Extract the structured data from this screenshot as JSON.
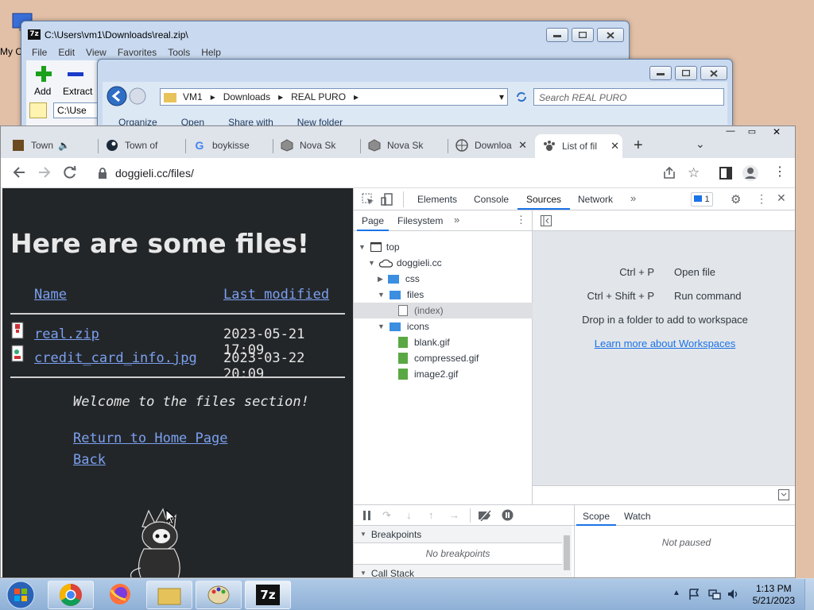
{
  "desktop": {
    "icon_label": "My C"
  },
  "zip_window": {
    "title": "C:\\Users\\vm1\\Downloads\\real.zip\\",
    "menu": [
      "File",
      "Edit",
      "View",
      "Favorites",
      "Tools",
      "Help"
    ],
    "add_label": "Add",
    "extract_label": "Extract",
    "path_partial": "C:\\Use"
  },
  "explorer_window": {
    "breadcrumb": [
      "VM1",
      "Downloads",
      "REAL PURO"
    ],
    "search_placeholder": "Search REAL PURO",
    "commands": [
      "Organize",
      "Open",
      "Share with",
      "New folder"
    ]
  },
  "browser": {
    "tabs": [
      {
        "label": "Town",
        "icon": "town-icon"
      },
      {
        "label": "Town of",
        "icon": "steam-icon"
      },
      {
        "label": "boykisse",
        "icon": "google-icon"
      },
      {
        "label": "Nova Sk",
        "icon": "cube-icon"
      },
      {
        "label": "Nova Sk",
        "icon": "cube-icon"
      },
      {
        "label": "Downloa",
        "icon": "globe-icon"
      },
      {
        "label": "List of fil",
        "icon": "paw-icon",
        "active": true
      }
    ],
    "url": "doggieli.cc/files/"
  },
  "page": {
    "heading": "Here are some files!",
    "col_name": "Name",
    "col_modified": "Last modified",
    "files": [
      {
        "name": "real.zip",
        "modified": "2023-05-21 17:09"
      },
      {
        "name": "credit_card_info.jpg",
        "modified": "2023-03-22 20:09"
      }
    ],
    "welcome": "Welcome to the files section!",
    "home_link": "Return to Home Page",
    "back_link": "Back"
  },
  "devtools": {
    "tabs": [
      "Elements",
      "Console",
      "Sources",
      "Network"
    ],
    "active_tab": "Sources",
    "issues_count": "1",
    "subtabs": [
      "Page",
      "Filesystem"
    ],
    "tree": {
      "top": "top",
      "domain": "doggieli.cc",
      "css": "css",
      "files": "files",
      "index": "(index)",
      "icons": "icons",
      "icon_files": [
        "blank.gif",
        "compressed.gif",
        "image2.gif"
      ]
    },
    "shortcuts": [
      {
        "keys": "Ctrl + P",
        "action": "Open file"
      },
      {
        "keys": "Ctrl + Shift + P",
        "action": "Run command"
      }
    ],
    "drop_hint": "Drop in a folder to add to workspace",
    "learn_more": "Learn more about Workspaces",
    "breakpoints_title": "Breakpoints",
    "no_breakpoints": "No breakpoints",
    "call_stack_title": "Call Stack",
    "scope_tab": "Scope",
    "watch_tab": "Watch",
    "not_paused": "Not paused"
  },
  "taskbar": {
    "time": "1:13 PM",
    "date": "5/21/2023",
    "zip_label": "7z"
  },
  "colors": {
    "page_bg": "#232629",
    "link": "#7ba0ef",
    "devtools_accent": "#1a73e8",
    "folder_blue": "#3c8fe0",
    "file_green": "#5aa843"
  }
}
